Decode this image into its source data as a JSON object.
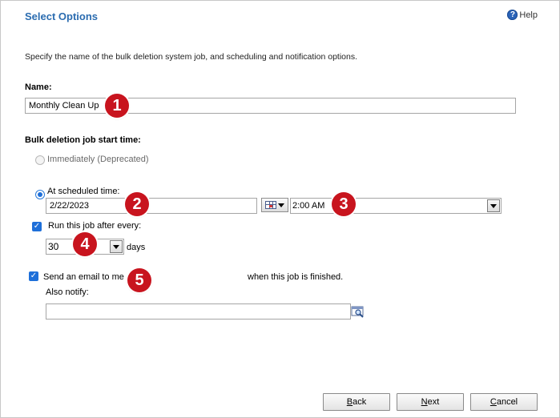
{
  "header": {
    "title": "Select Options",
    "help_label": "Help"
  },
  "description": "Specify the name of the bulk deletion system job, and scheduling and notification options.",
  "name_section": {
    "label": "Name:",
    "value": "Monthly Clean Up"
  },
  "start_time": {
    "label": "Bulk deletion job start time:",
    "immediately_label": "Immediately (Deprecated)",
    "immediately_selected": false,
    "scheduled_label": "At scheduled time:",
    "scheduled_selected": true,
    "date_value": "2/22/2023",
    "time_value": "2:00 AM"
  },
  "recurrence": {
    "checkbox_label": "Run this job after every:",
    "checked": true,
    "interval_value": "30",
    "unit_label": "days"
  },
  "notification": {
    "checkbox_label": "Send an email to me",
    "checked": true,
    "suffix_label": "when this job is finished.",
    "also_notify_label": "Also notify:",
    "also_notify_value": ""
  },
  "badges": [
    "1",
    "2",
    "3",
    "4",
    "5"
  ],
  "footer": {
    "back_label": "Back",
    "back_access_key": "B",
    "back_rest": "ack",
    "next_label": "Next",
    "next_access_key": "N",
    "next_rest": "ext",
    "cancel_label": "Cancel",
    "cancel_access_key": "C",
    "cancel_rest": "ancel"
  },
  "icons": {
    "help": "help-icon",
    "calendar": "calendar-icon",
    "lookup": "lookup-icon",
    "dropdown": "chevron-down-icon"
  },
  "colors": {
    "title": "#2b6cb0",
    "accent": "#1e6fd9",
    "badge": "#c8141e"
  }
}
